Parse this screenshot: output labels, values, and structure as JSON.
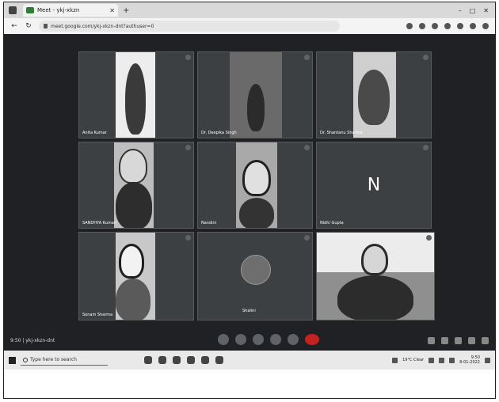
{
  "browser": {
    "tab_title": "Meet - ykj-xkzn",
    "url": "meet.google.com/ykj-xkzn-dnt?authuser=0",
    "window_controls": [
      "–",
      "□",
      "✕"
    ]
  },
  "meeting": {
    "info": "9:50 | ykj-xkzn-dnt",
    "participants": [
      {
        "name": "Anita Kumar"
      },
      {
        "name": "Dr. Deepika Singh"
      },
      {
        "name": "Dr. Shantanu Sharma"
      },
      {
        "name": "SANDHYA Kumari"
      },
      {
        "name": "Nandini"
      },
      {
        "name": "Nidhi Gupta",
        "initial": "N"
      },
      {
        "name": "Sonam Sharma"
      },
      {
        "name": "Shalini"
      },
      {
        "name": ""
      }
    ]
  },
  "taskbar": {
    "search_placeholder": "Type here to search",
    "weather": "19°C Clear",
    "time": "9:50",
    "date": "8-01-2022"
  },
  "colors": {
    "meet_bg": "#202124",
    "tile_bg": "#3c4043",
    "leave_red": "#c5221f"
  }
}
